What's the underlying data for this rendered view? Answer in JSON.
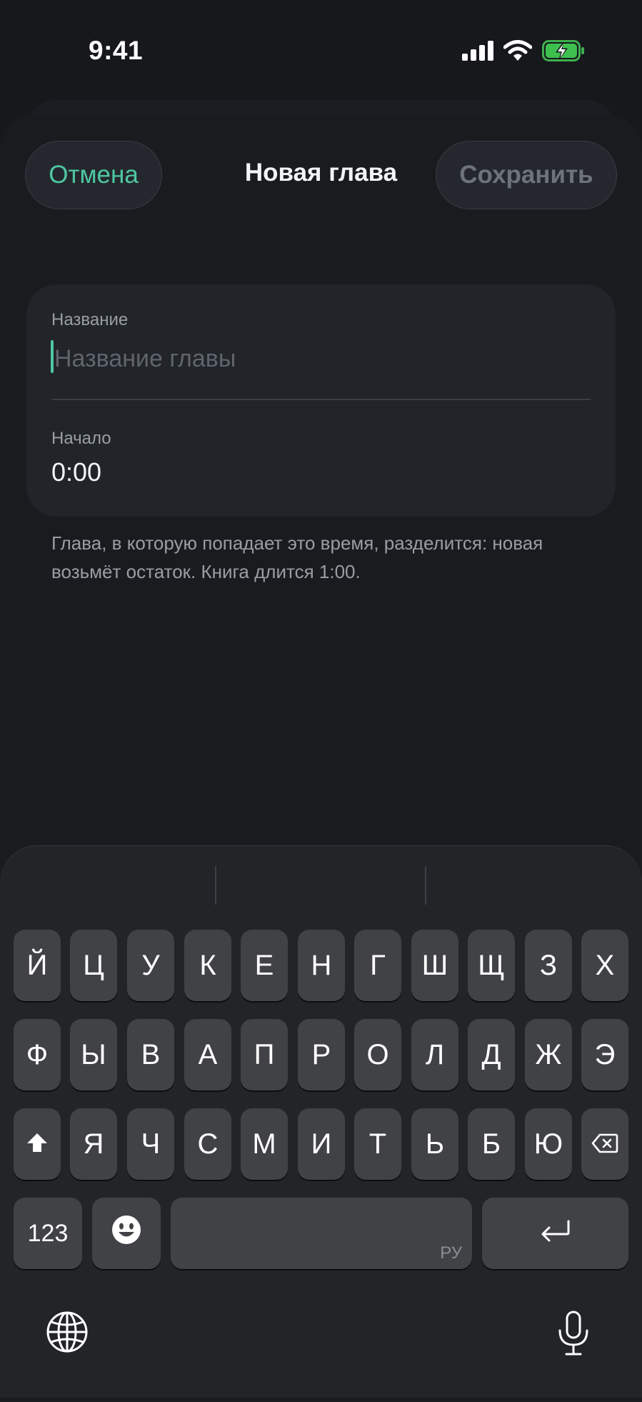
{
  "status_bar": {
    "time": "9:41",
    "icons": [
      "cellular-signal-icon",
      "wifi-icon",
      "battery-charging-icon"
    ]
  },
  "nav": {
    "cancel_label": "Отмена",
    "title": "Новая глава",
    "save_label": "Сохранить"
  },
  "form": {
    "name_label": "Название",
    "name_value": "",
    "name_placeholder": "Название главы",
    "start_label": "Начало",
    "start_value": "0:00"
  },
  "hint": "Глава, в которую попадает это время, разделится: новая возьмёт остаток. Книга длится 1:00.",
  "keyboard": {
    "row1": [
      "Й",
      "Ц",
      "У",
      "К",
      "Е",
      "Н",
      "Г",
      "Ш",
      "Щ",
      "З",
      "Х"
    ],
    "row2": [
      "Ф",
      "Ы",
      "В",
      "А",
      "П",
      "Р",
      "О",
      "Л",
      "Д",
      "Ж",
      "Э"
    ],
    "row3": [
      "Я",
      "Ч",
      "С",
      "М",
      "И",
      "Т",
      "Ь",
      "Б",
      "Ю"
    ],
    "numbers_label": "123",
    "space_lang_hint": "РУ",
    "icons": [
      "shift-icon",
      "backspace-icon",
      "emoji-icon",
      "return-icon",
      "globe-icon",
      "microphone-icon"
    ]
  },
  "colors": {
    "accent": "#4fc7a3",
    "background": "#16181c",
    "card": "#212429",
    "key": "#414246",
    "disabled_text": "#6e737b"
  }
}
